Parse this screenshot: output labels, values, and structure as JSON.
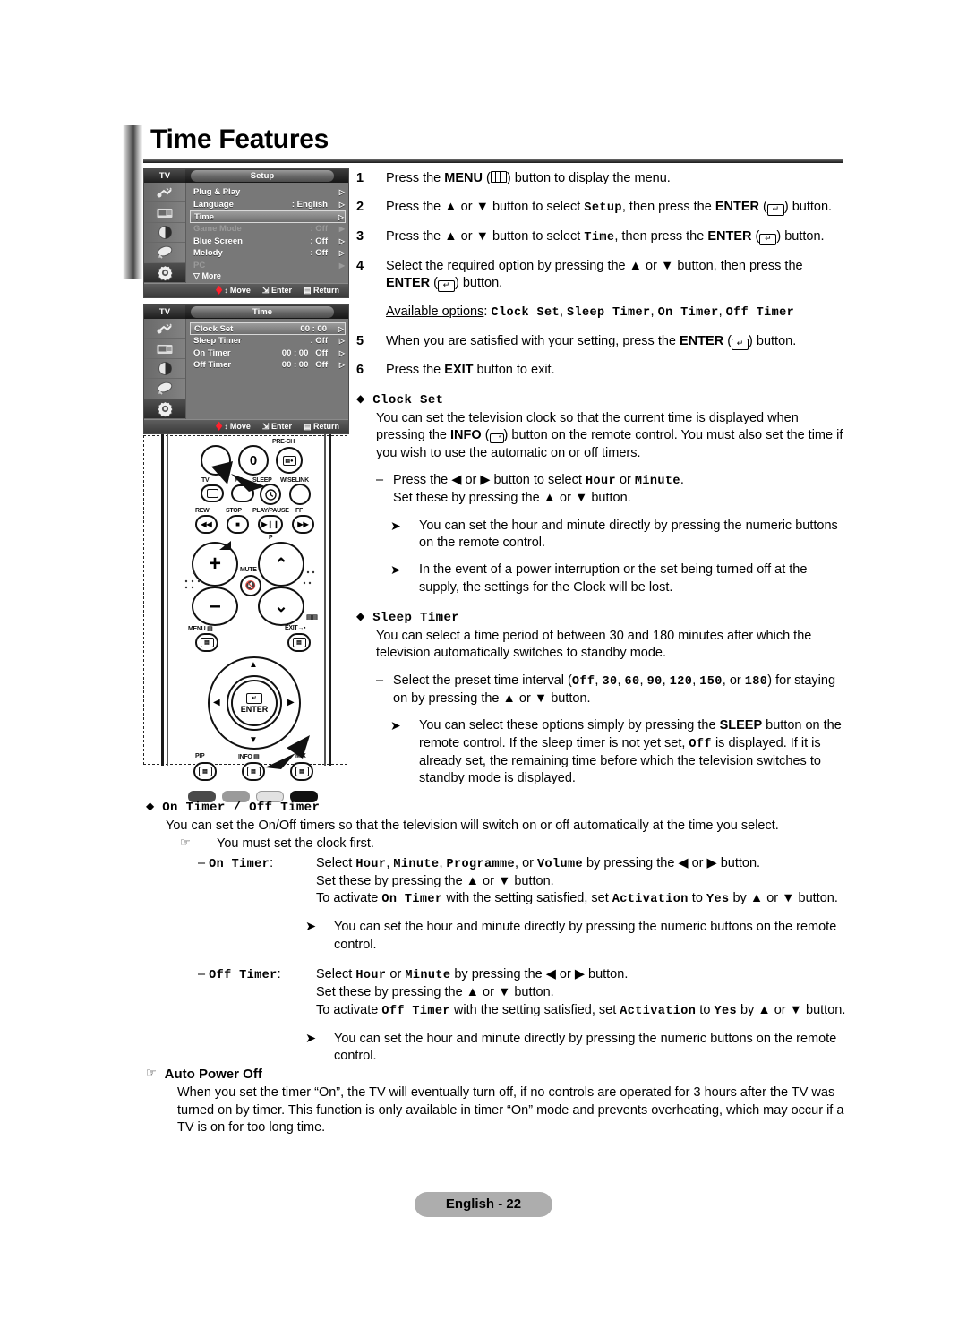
{
  "page": {
    "title": "Time Features",
    "footer_label": "English - 22"
  },
  "osd_setup": {
    "source_label": "TV",
    "menu_title": "Setup",
    "rows": [
      {
        "label": "Plug & Play",
        "value": "",
        "arrow": "hollow",
        "state": "normal"
      },
      {
        "label": "Language",
        "value": ": English",
        "arrow": "hollow",
        "state": "normal"
      },
      {
        "label": "Time",
        "value": "",
        "arrow": "hollow",
        "state": "highlighted"
      },
      {
        "label": "Game Mode",
        "value": ": Off",
        "arrow": "solid",
        "state": "dimmed"
      },
      {
        "label": "Blue Screen",
        "value": ": Off",
        "arrow": "hollow",
        "state": "normal"
      },
      {
        "label": "Melody",
        "value": ": Off",
        "arrow": "hollow",
        "state": "normal"
      },
      {
        "label": "PC",
        "value": "",
        "arrow": "solid",
        "state": "dimmed"
      }
    ],
    "more_label": "More",
    "footer": {
      "move": "Move",
      "enter": "Enter",
      "return": "Return"
    }
  },
  "osd_time": {
    "source_label": "TV",
    "menu_title": "Time",
    "rows": [
      {
        "label": "Clock Set",
        "value": "00 : 00",
        "arrow": "hollow",
        "state": "highlighted"
      },
      {
        "label": "Sleep Timer",
        "value": ": Off",
        "arrow": "hollow",
        "state": "normal"
      },
      {
        "label": "On Timer",
        "value": "00 : 00   Off",
        "arrow": "hollow",
        "state": "normal"
      },
      {
        "label": "Off Timer",
        "value": "00 : 00   Off",
        "arrow": "hollow",
        "state": "normal"
      }
    ],
    "footer": {
      "move": "Move",
      "enter": "Enter",
      "return": "Return"
    }
  },
  "remote": {
    "labels": {
      "prech": "PRE-CH",
      "zero": "0",
      "tv": "TV",
      "pr": "PR",
      "sleep": "SLEEP",
      "wiselink": "WISELINK",
      "rew": "REW",
      "stop": "STOP",
      "playpause": "PLAY/PAUSE",
      "ff": "FF",
      "p": "P",
      "mute": "MUTE",
      "menu": "MENU",
      "exit": "EXIT",
      "enter": "ENTER",
      "pip": "PIP",
      "info": "INFO",
      "mix": "MIX",
      "plus": "+",
      "minus": "–"
    }
  },
  "steps": [
    {
      "num": "1",
      "text_parts": [
        {
          "t": "Press the ",
          "s": "n"
        },
        {
          "t": "MENU",
          "s": "b"
        },
        {
          "t": " (▥) button to display the menu.",
          "s": "n"
        }
      ]
    },
    {
      "num": "2",
      "text_parts": [
        {
          "t": "Press the ▲ or ▼ button to select ",
          "s": "n"
        },
        {
          "t": "Setup",
          "s": "m"
        },
        {
          "t": ", then press the ",
          "s": "n"
        },
        {
          "t": "ENTER",
          "s": "b"
        },
        {
          "t": " (↵) button.",
          "s": "n"
        }
      ]
    },
    {
      "num": "3",
      "text_parts": [
        {
          "t": "Press the ▲ or ▼ button to select ",
          "s": "n"
        },
        {
          "t": "Time",
          "s": "m"
        },
        {
          "t": ", then press the ",
          "s": "n"
        },
        {
          "t": "ENTER",
          "s": "b"
        },
        {
          "t": " (↵) button.",
          "s": "n"
        }
      ]
    },
    {
      "num": "4",
      "text_parts": [
        {
          "t": "Select the required option by pressing the ▲ or ▼ button, then press the ",
          "s": "n"
        },
        {
          "t": "ENTER",
          "s": "b"
        },
        {
          "t": " (↵) button.",
          "s": "n"
        }
      ]
    },
    {
      "num": "5",
      "text_parts": [
        {
          "t": "When you are satisfied with your setting, press the ",
          "s": "n"
        },
        {
          "t": "ENTER",
          "s": "b"
        },
        {
          "t": " (↵) button.",
          "s": "n"
        }
      ]
    },
    {
      "num": "6",
      "text_parts": [
        {
          "t": "Press the ",
          "s": "n"
        },
        {
          "t": "EXIT",
          "s": "b"
        },
        {
          "t": " button to exit.",
          "s": "n"
        }
      ]
    }
  ],
  "available_options": {
    "label": "Available options",
    "sep": ": ",
    "options": [
      "Clock Set",
      "Sleep Timer",
      "On Timer",
      "Off Timer"
    ]
  },
  "clock_set": {
    "heading": "Clock Set",
    "body_1": "You can set the television clock so that the current time is displayed when pressing the ",
    "body_info": "INFO",
    "body_2": " (▭) button on the remote control. You must also set the time if you wish to use the automatic on or off timers.",
    "sub": {
      "line1_a": "Press the ◀ or ▶ button to select ",
      "line1_hour": "Hour",
      "line1_or": " or ",
      "line1_minute": "Minute",
      "line1_end": ".",
      "line2": "Set these by pressing the ▲ or ▼ button."
    },
    "notes": [
      "You can set the hour and minute directly by pressing the numeric buttons on the remote control.",
      "In the event of a power interruption or the set being turned off at the supply, the settings for the Clock will be lost."
    ]
  },
  "sleep_timer": {
    "heading": "Sleep Timer",
    "body": "You can select a time period of between 30 and 180 minutes after which the television automatically switches to standby mode.",
    "sub": {
      "prefix": "Select the preset time interval (",
      "values": [
        "Off",
        "30",
        "60",
        "90",
        "120",
        "150",
        "180"
      ],
      "or_word": "or ",
      "suffix": ") for staying on by pressing the ▲ or ▼ button."
    },
    "note": {
      "a": "You can select these options simply by pressing the ",
      "sleep": "SLEEP",
      "b": " button on the remote control. If the sleep timer is not yet set, ",
      "off": "Off",
      "c": " is displayed. If it is already set, the remaining time before which the television switches to standby mode is displayed."
    }
  },
  "on_off_timer": {
    "heading_on": "On Timer",
    "heading_sep": " / ",
    "heading_off": "Off Timer",
    "body": "You can set the On/Off timers so that the television will switch on or off automatically at the time you select.",
    "hand_note": "You must set the clock first.",
    "on": {
      "key": "On Timer",
      "key_colon": ":",
      "line1_a": "Select ",
      "line1_fields": [
        "Hour",
        "Minute",
        "Programme"
      ],
      "line1_or": "or ",
      "line1_volume": "Volume",
      "line1_b": " by pressing the ◀ or ▶ button.",
      "line2": "Set these by pressing the ▲ or ▼ button.",
      "line3_a": "To activate ",
      "line3_key": "On Timer",
      "line3_b": " with the setting satisfied, set ",
      "line3_activation": "Activation",
      "line3_c": " to ",
      "line3_yes": "Yes",
      "line3_d": " by ▲ or ▼ button."
    },
    "on_note": "You can set the hour and minute directly by pressing the numeric buttons on the remote control.",
    "off": {
      "key": "Off Timer",
      "key_colon": ":",
      "line1_a": "Select ",
      "line1_hour": "Hour",
      "line1_or": " or ",
      "line1_minute": "Minute",
      "line1_b": " by pressing the ◀ or ▶ button.",
      "line2": "Set these by pressing the ▲ or ▼ button.",
      "line3_a": "To activate ",
      "line3_key": "Off Timer",
      "line3_b": " with the setting satisfied, set ",
      "line3_activation": "Activation",
      "line3_c": " to ",
      "line3_yes": "Yes",
      "line3_d": " by ▲ or ▼ button."
    },
    "off_note": "You can set the hour and minute directly by pressing the numeric buttons on the remote control."
  },
  "auto_power_off": {
    "heading": "Auto Power Off",
    "body": "When you set the timer “On”, the TV will eventually turn off, if no controls are operated for 3 hours after the TV was turned on by timer. This function is only available in timer “On” mode and prevents overheating, which may occur if a TV is on for too long time."
  }
}
